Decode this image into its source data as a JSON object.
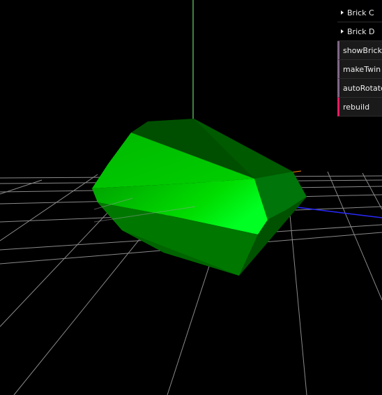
{
  "gui": {
    "folders": [
      {
        "label": "Brick C"
      },
      {
        "label": "Brick D"
      }
    ],
    "controls": [
      {
        "label": "showBricks",
        "type": "boolean"
      },
      {
        "label": "makeTwin",
        "type": "boolean"
      },
      {
        "label": "autoRotate",
        "type": "boolean"
      },
      {
        "label": "rebuild",
        "type": "function"
      }
    ]
  },
  "colors": {
    "background": "#000000",
    "gem_main": "#00cc00",
    "y_axis": "#7fff7f",
    "z_axis": "#2222ff",
    "grid": "#888888",
    "boolean_accent": "#806787",
    "function_accent": "#e61d5f"
  }
}
